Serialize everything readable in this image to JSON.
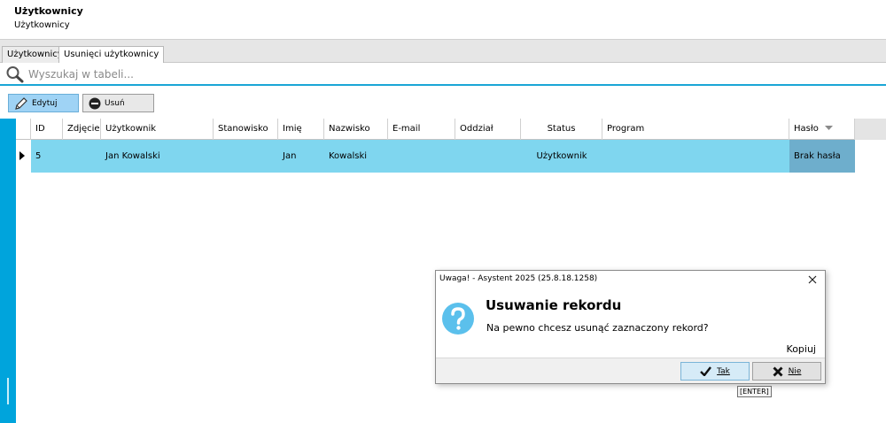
{
  "header": {
    "title": "Użytkownicy",
    "subtitle": "Użytkownicy"
  },
  "tabs": [
    {
      "label": "Użytkownicy",
      "active": false
    },
    {
      "label": "Usunięci użytkownicy",
      "active": true
    }
  ],
  "search": {
    "placeholder": "Wyszukaj w tabeli...",
    "value": ""
  },
  "toolbar": {
    "edit_label": "Edytuj",
    "delete_label": "Usuń"
  },
  "grid": {
    "columns": [
      "ID",
      "Zdjęcie",
      "Użytkownik",
      "Stanowisko",
      "Imię",
      "Nazwisko",
      "E-mail",
      "Oddział",
      "Status",
      "Program",
      "Hasło"
    ],
    "rows": [
      {
        "id": "5",
        "zdjecie": "",
        "uzytkownik": "Jan Kowalski",
        "stanowisko": "",
        "imie": "Jan",
        "nazwisko": "Kowalski",
        "email": "",
        "oddzial": "",
        "status": "Użytkownik",
        "program": "",
        "haslo": "Brak hasła"
      }
    ],
    "sort_column": "Hasło",
    "selected_color": "#7fd6ef"
  },
  "dialog": {
    "title": "Uwaga! - Asystent 2025 (25.8.18.1258)",
    "heading": "Usuwanie rekordu",
    "message": "Na pewno chcesz usunąć zaznaczony rekord?",
    "copy_label": "Kopiuj",
    "yes_label": "Tak",
    "no_label": "Nie",
    "tooltip": "[ENTER]"
  },
  "colors": {
    "accent": "#00a4dc",
    "question_icon": "#5bc0ec"
  }
}
